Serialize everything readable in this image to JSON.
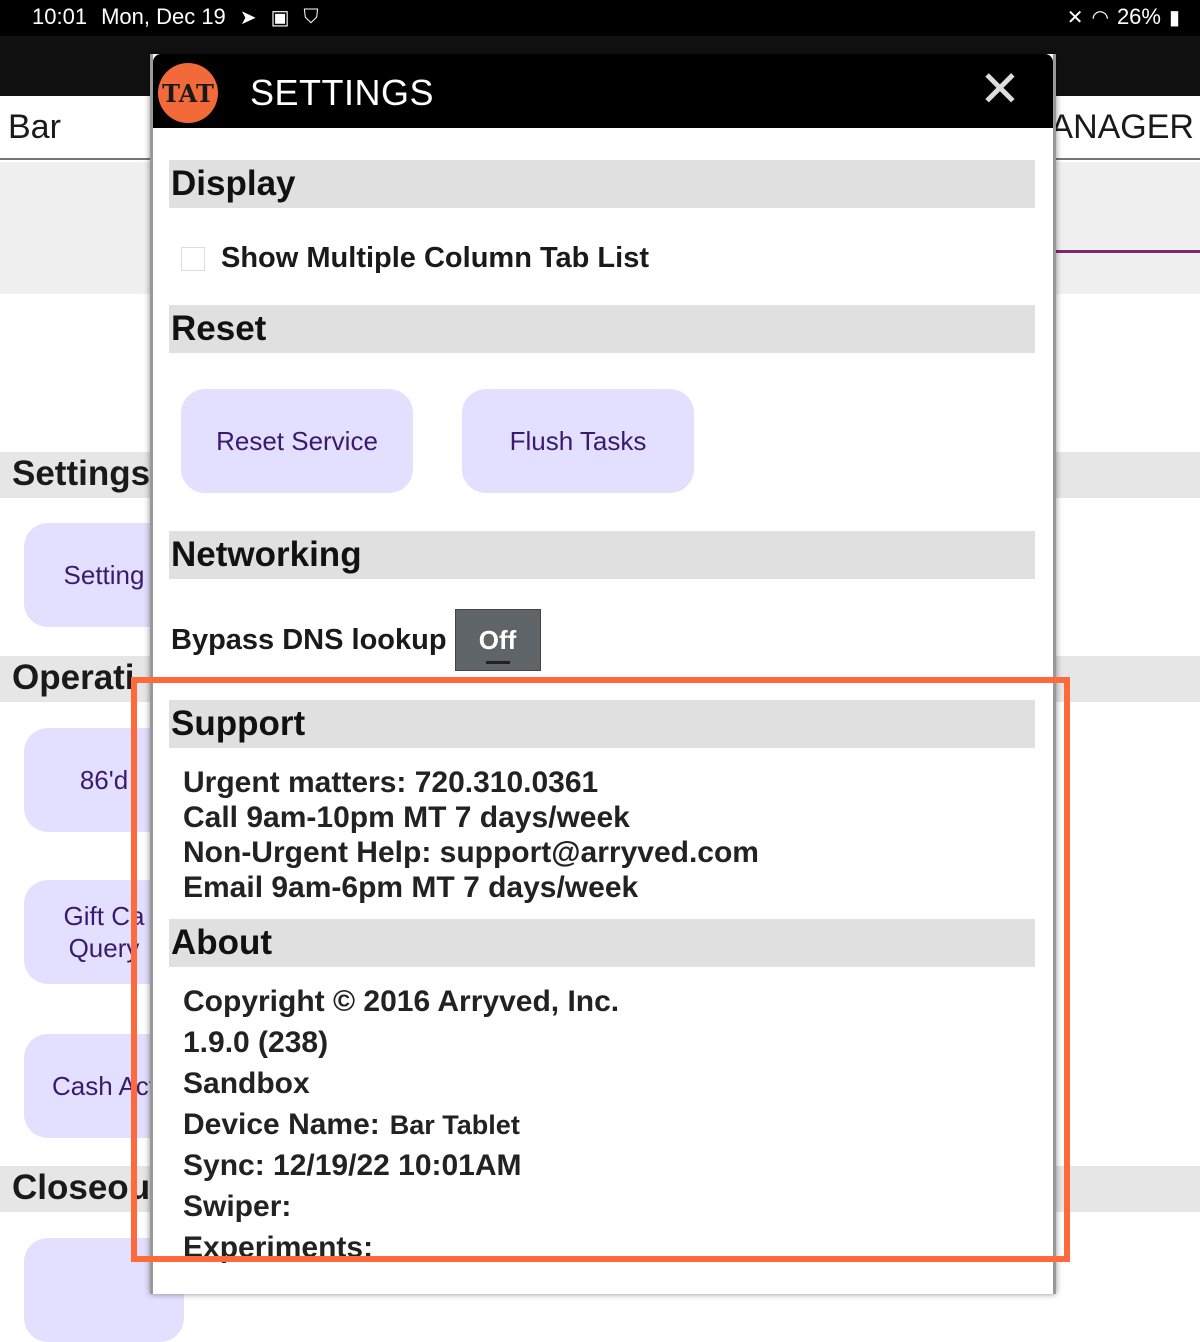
{
  "status_bar": {
    "time": "10:01",
    "date": "Mon, Dec 19",
    "battery": "26%",
    "icons": [
      "send-icon",
      "image-icon",
      "shield-icon",
      "mute-icon",
      "wifi-icon",
      "battery-icon"
    ]
  },
  "background": {
    "nav_left": "Bar",
    "nav_right": "MANAGER",
    "sections": {
      "settings": "Settings",
      "operations": "Operati",
      "closeout": "Closeou"
    },
    "buttons": {
      "settings": "Setting",
      "eighty_six": "86'd",
      "gift_card": "Gift Ca\nQuery",
      "cash_actions": "Cash Act"
    }
  },
  "dialog": {
    "title": "SETTINGS",
    "logo_text": "TAT",
    "close_glyph": "✕",
    "sections": {
      "display": "Display",
      "reset": "Reset",
      "networking": "Networking",
      "support": "Support",
      "about": "About"
    },
    "display": {
      "multi_column_label": "Show Multiple Column Tab List",
      "multi_column_checked": false
    },
    "reset": {
      "reset_service": "Reset Service",
      "flush_tasks": "Flush Tasks"
    },
    "networking": {
      "bypass_dns_label": "Bypass DNS lookup",
      "bypass_dns_state": "Off"
    },
    "support": {
      "line1": "Urgent matters: 720.310.0361",
      "line2": "Call 9am-10pm MT 7 days/week",
      "line3": "Non-Urgent Help: support@arryved.com",
      "line4": "Email 9am-6pm MT 7 days/week"
    },
    "about": {
      "copyright": "Copyright © 2016 Arryved, Inc.",
      "version": "1.9.0 (238)",
      "environment": "Sandbox",
      "device_name_label": "Device Name:",
      "device_name_value": "Bar Tablet",
      "sync": "Sync: 12/19/22 10:01AM",
      "swiper": "Swiper:",
      "experiments": "Experiments:"
    }
  },
  "colors": {
    "button_bg": "#e3e0ff",
    "button_text": "#3b1a6e",
    "highlight": "#ff6a3d",
    "logo": "#f26a3a"
  }
}
